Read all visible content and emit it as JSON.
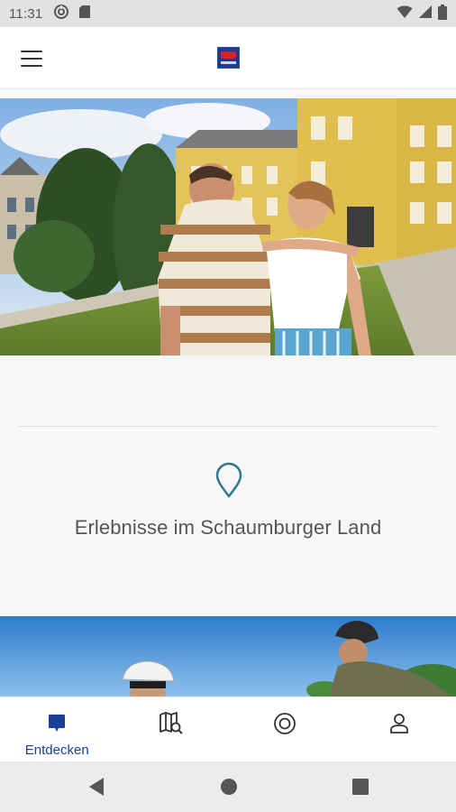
{
  "status_bar": {
    "time": "11:31",
    "left_icons": [
      "data-saver-icon",
      "sd-card-icon"
    ],
    "right_icons": [
      "wifi-icon",
      "signal-icon",
      "battery-icon"
    ]
  },
  "header": {
    "menu_icon": "hamburger-menu-icon",
    "logo": "schaumburger-land-logo"
  },
  "hero": {
    "image": "couple-in-front-of-castle-photo"
  },
  "info": {
    "icon": "location-pin-icon",
    "title": "Erlebnisse im Schaumburger Land",
    "accent_color": "#2c7a8c"
  },
  "strip": {
    "image": "cyclists-with-helmets-photo"
  },
  "bottom_nav": {
    "items": [
      {
        "label": "Entdecken",
        "icon": "discover-chat-icon",
        "active": true
      },
      {
        "label": "",
        "icon": "map-search-icon",
        "active": false
      },
      {
        "label": "",
        "icon": "target-icon",
        "active": false
      },
      {
        "label": "",
        "icon": "profile-icon",
        "active": false
      }
    ],
    "active_color": "#1a3f98"
  },
  "system_nav": {
    "buttons": [
      "back-icon",
      "home-icon",
      "recents-icon"
    ]
  }
}
